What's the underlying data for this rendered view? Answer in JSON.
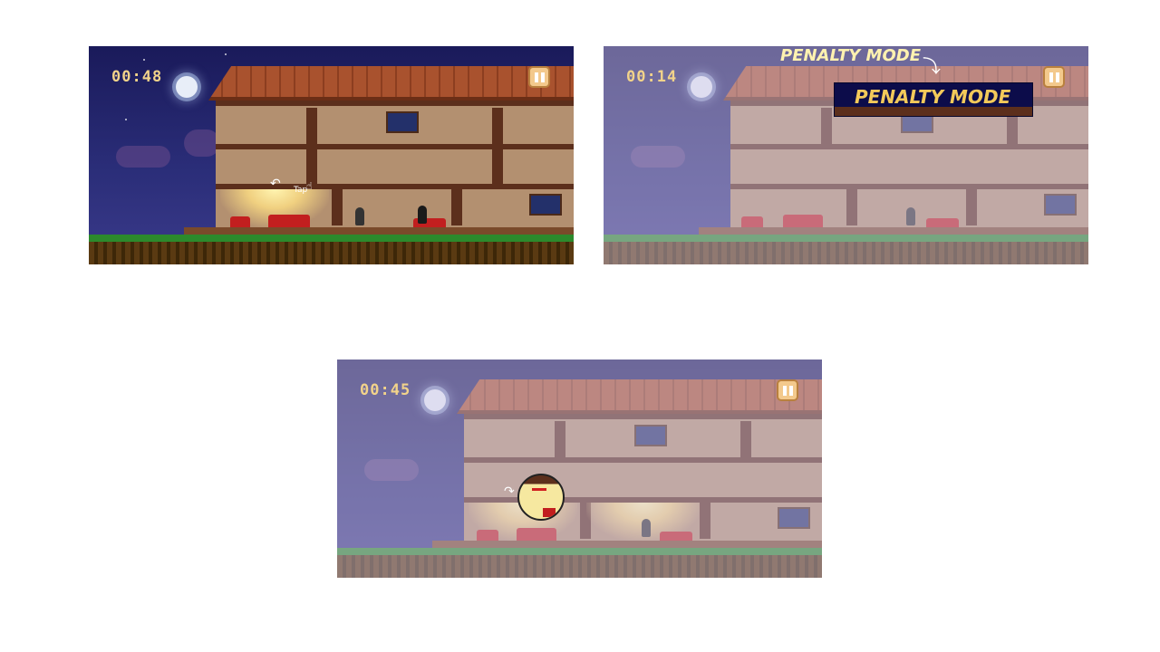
{
  "panels": [
    {
      "timer": "00:48",
      "gesture_hint": "Tap"
    },
    {
      "timer": "00:14",
      "penalty_caption": "PENALTY MODE",
      "penalty_banner": "PENALTY MODE"
    },
    {
      "timer": "00:45"
    }
  ],
  "icons": {
    "pause": "pause-icon",
    "moon": "moon-icon",
    "swipe": "swipe-arrow-icon",
    "tap": "tap-hand-icon",
    "magnifier": "magnifier-icon"
  },
  "colors": {
    "sky": "#2a2d78",
    "timer_text": "#f2d38a",
    "pause_button": "#f3c98c",
    "penalty_text": "#f3c95a",
    "penalty_banner_bg": "#0c0c4a",
    "sofa": "#c21f1f",
    "grass": "#2c8a2c"
  }
}
